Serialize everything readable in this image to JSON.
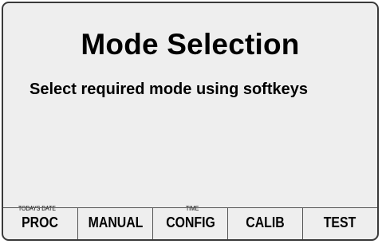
{
  "screen": {
    "title": "Mode Selection",
    "instruction": "Select required mode using softkeys"
  },
  "status": {
    "date_label": "TODAYS DATE",
    "time_label": "TIME"
  },
  "softkeys": [
    {
      "label": "PROC"
    },
    {
      "label": "MANUAL"
    },
    {
      "label": "CONFIG"
    },
    {
      "label": "CALIB"
    },
    {
      "label": "TEST"
    }
  ]
}
